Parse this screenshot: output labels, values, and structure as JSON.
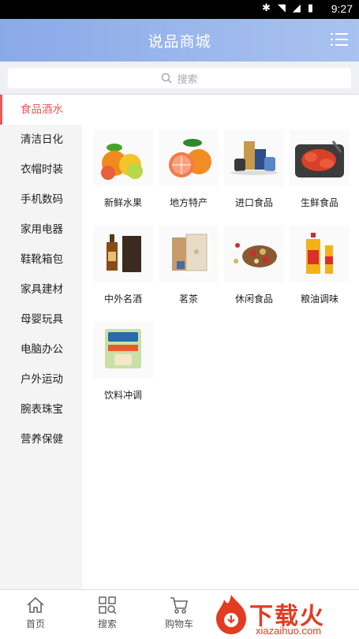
{
  "status_bar": {
    "time": "9:27"
  },
  "header": {
    "title": "说品商城"
  },
  "search": {
    "placeholder": "搜索"
  },
  "sidebar": {
    "items": [
      {
        "label": "食品酒水",
        "active": true
      },
      {
        "label": "清洁日化"
      },
      {
        "label": "衣帽时装"
      },
      {
        "label": "手机数码"
      },
      {
        "label": "家用电器"
      },
      {
        "label": "鞋靴箱包"
      },
      {
        "label": "家具建材"
      },
      {
        "label": "母婴玩具"
      },
      {
        "label": "电脑办公"
      },
      {
        "label": "户外运动"
      },
      {
        "label": "腕表珠宝"
      },
      {
        "label": "营养保健"
      }
    ]
  },
  "categories": [
    {
      "label": "新鲜水果",
      "icon": "fruit-image"
    },
    {
      "label": "地方特产",
      "icon": "grapefruit-image"
    },
    {
      "label": "进口食品",
      "icon": "imported-food-image"
    },
    {
      "label": "生鲜食品",
      "icon": "seafood-image"
    },
    {
      "label": "中外名酒",
      "icon": "liquor-image"
    },
    {
      "label": "茗茶",
      "icon": "tea-image"
    },
    {
      "label": "休闲食品",
      "icon": "snacks-image"
    },
    {
      "label": "粮油调味",
      "icon": "cooking-oil-image"
    },
    {
      "label": "饮料冲调",
      "icon": "beverage-image"
    }
  ],
  "bottom_nav": [
    {
      "label": "首页",
      "icon": "home-icon"
    },
    {
      "label": "搜索",
      "icon": "grid-search-icon"
    },
    {
      "label": "购物车",
      "icon": "cart-icon"
    }
  ],
  "watermark": {
    "text": "下载火",
    "sub": "xiazaihuo.com"
  },
  "colors": {
    "header": "#8aa9e8",
    "accent": "#e45b5b",
    "watermark": "#e23c21"
  }
}
